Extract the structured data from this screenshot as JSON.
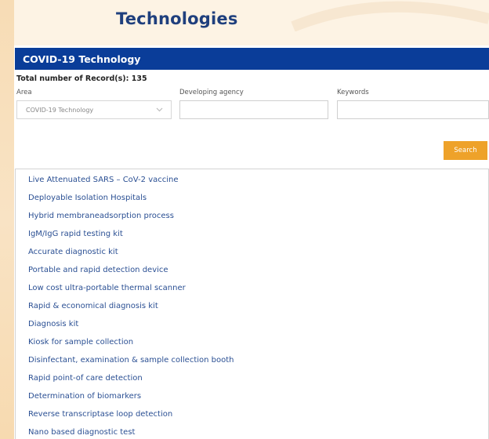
{
  "page": {
    "title": "Technologies"
  },
  "section": {
    "title": "COVID-19 Technology"
  },
  "filters": {
    "total_label": "Total number of Record(s): 135",
    "area_label": "Area",
    "area_value": "COVID-19 Technology",
    "agency_label": "Developing agency",
    "agency_value": "",
    "keywords_label": "Keywords",
    "keywords_value": "",
    "search_label": "Search"
  },
  "results": [
    "Live Attenuated SARS – CoV-2 vaccine",
    "Deployable Isolation Hospitals",
    "Hybrid membraneadsorption process",
    "IgM/IgG rapid testing kit",
    "Accurate diagnostic kit",
    "Portable and rapid detection device",
    "Low cost ultra-portable thermal scanner",
    "Rapid & economical diagnosis kit",
    "Diagnosis kit",
    "Kiosk for sample collection",
    "Disinfectant, examination & sample collection booth",
    "Rapid point-of care detection",
    "Determination of biomarkers",
    "Reverse transcriptase loop detection",
    "Nano based diagnostic test"
  ],
  "colors": {
    "section_bar": "#0a3d99",
    "title": "#1f3f7d",
    "link": "#2a4f93",
    "search_button": "#eea22a"
  }
}
